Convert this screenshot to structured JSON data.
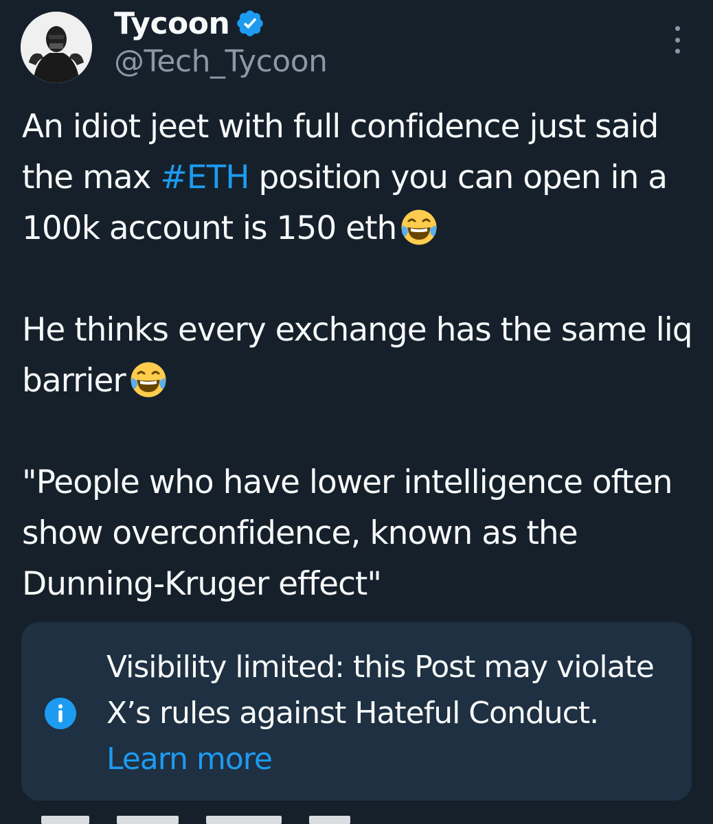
{
  "author": {
    "display_name": "Tycoon",
    "handle": "@Tech_Tycoon"
  },
  "post": {
    "p1_before": "An idiot jeet with full confidence just said the max ",
    "p1_hashtag": "#ETH",
    "p1_after": " position you can open in a 100k account is 150 eth",
    "p2": "He thinks every exchange has the same liq barrier",
    "p3": "\"People who have lower intelligence often show overconfidence, known as the Dunning-Kruger effect\""
  },
  "notice": {
    "text": "Visibility limited: this Post may violate X’s rules against Hateful Conduct.",
    "link": "Learn more"
  },
  "icons": {
    "verified": "verified-badge-icon",
    "more": "more-options-icon",
    "emoji": "face-with-tears-of-joy",
    "info": "info-icon"
  },
  "colors": {
    "background": "#15202b",
    "text": "#f7f9f9",
    "muted": "#8b98a5",
    "accent": "#1d9bf0",
    "notice_bg": "#1e3041"
  }
}
